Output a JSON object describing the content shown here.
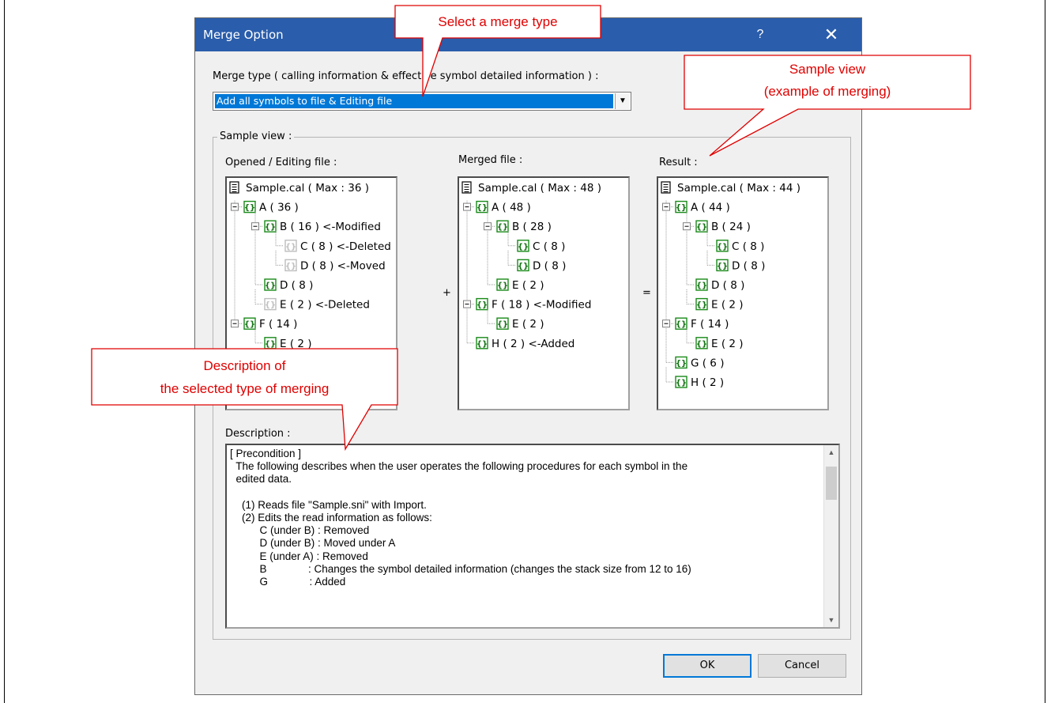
{
  "dialog": {
    "title": "Merge Option",
    "help_glyph": "?",
    "close_glyph": "✕",
    "merge_type_label": "Merge type ( calling information & effective symbol detailed information ) :",
    "merge_type_value": "Add all symbols to file & Editing file",
    "sample_view_label": "Sample view :",
    "panels": {
      "opened_label": "Opened / Editing file :",
      "merged_label": "Merged file :",
      "result_label": "Result :"
    },
    "plus": "+",
    "equals": "=",
    "description_label": "Description :",
    "ok": "OK",
    "cancel": "Cancel"
  },
  "trees": {
    "opened": [
      "Sample.cal ( Max : 36 )",
      "A ( 36 )",
      "B ( 16 ) <-Modified",
      "C ( 8 ) <-Deleted",
      "D ( 8 ) <-Moved",
      "D ( 8 )",
      "E ( 2 ) <-Deleted",
      "F ( 14 )",
      "E ( 2 )"
    ],
    "merged": [
      "Sample.cal ( Max : 48 )",
      "A ( 48 )",
      "B ( 28 )",
      "C ( 8 )",
      "D ( 8 )",
      "E ( 2 )",
      "F ( 18 ) <-Modified",
      "E ( 2 )",
      "H ( 2 ) <-Added"
    ],
    "result": [
      "Sample.cal ( Max : 44 )",
      "A ( 44 )",
      "B ( 24 )",
      "C ( 8 )",
      "D ( 8 )",
      "D ( 8 )",
      "E ( 2 )",
      "F ( 14 )",
      "E ( 2 )",
      "G ( 6 )",
      "H ( 2 )"
    ]
  },
  "description_lines": [
    "[ Precondition ]",
    "  The following describes when the user operates the following procedures for each symbol in the",
    "  edited data.",
    "",
    "    (1) Reads file \"Sample.sni\" with Import.",
    "    (2) Edits the read information as follows:",
    "          C (under B) : Removed",
    "          D (under B) : Moved under A",
    "          E (under A) : Removed",
    "          B              : Changes the symbol detailed information (changes the stack size from 12 to 16)",
    "          G              : Added"
  ],
  "callouts": {
    "select_type": "Select a merge type",
    "sample_view_line1": "Sample view",
    "sample_view_line2": "(example of merging)",
    "description_line1": "Description of",
    "description_line2": "the selected type of merging"
  },
  "colors": {
    "callout": "#e00000",
    "titlebar": "#2a5dab",
    "selection": "#0078d7",
    "symbol_green": "#1a8a1a"
  }
}
